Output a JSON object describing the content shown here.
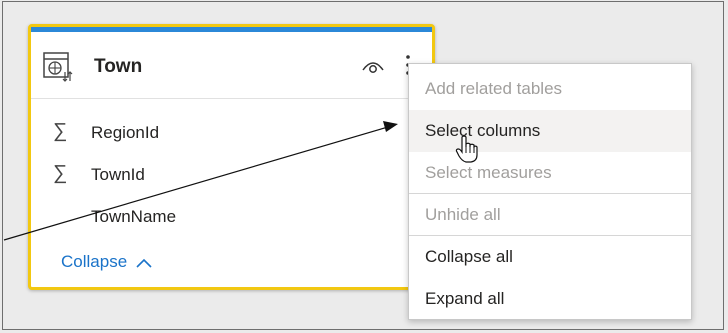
{
  "table_card": {
    "title": "Town",
    "icons": {
      "table": "table-icon",
      "visibility": "eye-icon",
      "more": "more-options-icon"
    },
    "fields": [
      {
        "label": "RegionId",
        "icon": "sigma-icon"
      },
      {
        "label": "TownId",
        "icon": "sigma-icon"
      },
      {
        "label": "TownName",
        "icon": ""
      }
    ],
    "collapse_label": "Collapse",
    "accent_color": "#f2c811",
    "header_color": "#2b88d8"
  },
  "context_menu": {
    "items": [
      {
        "label": "Add related tables",
        "state": "disabled"
      },
      {
        "label": "Select columns",
        "state": "hover"
      },
      {
        "label": "Select measures",
        "state": "disabled"
      },
      {
        "label": "Unhide all",
        "state": "disabled"
      },
      {
        "label": "Collapse all",
        "state": "enabled"
      },
      {
        "label": "Expand all",
        "state": "enabled"
      }
    ]
  },
  "annotation": {
    "type": "arrow",
    "target": "Select columns"
  },
  "cursor": "hand-pointer-icon"
}
